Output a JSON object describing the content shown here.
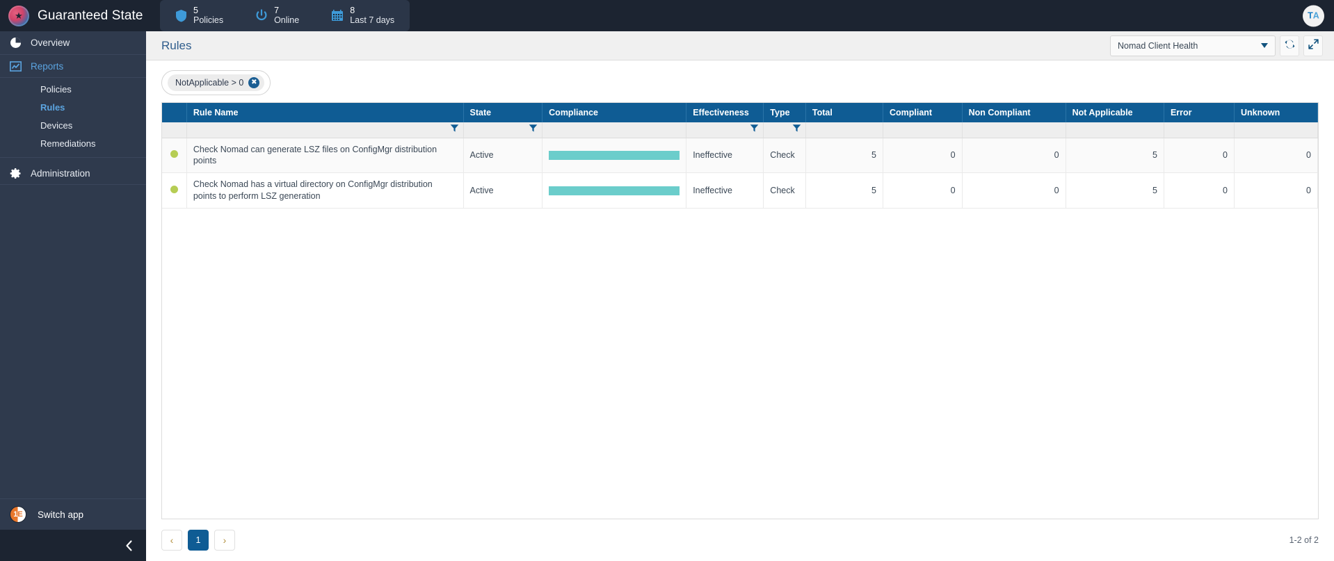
{
  "topbar": {
    "brand": "Guaranteed State",
    "brand_logo_icon": "star-circle-logo",
    "stats": [
      {
        "icon": "shield-icon",
        "value": "5",
        "label": "Policies"
      },
      {
        "icon": "power-icon",
        "value": "7",
        "label": "Online"
      },
      {
        "icon": "calendar-icon",
        "value": "8",
        "label": "Last 7 days"
      }
    ],
    "avatar_initials_1": "T",
    "avatar_initials_2": "A"
  },
  "sidebar": {
    "items": [
      {
        "label": "Overview",
        "icon": "pie-chart-icon"
      },
      {
        "label": "Reports",
        "icon": "line-chart-icon"
      }
    ],
    "report_children": [
      {
        "label": "Policies"
      },
      {
        "label": "Rules"
      },
      {
        "label": "Devices"
      },
      {
        "label": "Remediations"
      }
    ],
    "administration": {
      "label": "Administration",
      "icon": "gear-icon"
    },
    "switch_app": {
      "label": "Switch app",
      "icon": "one-e-logo-icon"
    },
    "collapse_icon": "chevron-left-icon"
  },
  "header": {
    "title": "Rules",
    "policy_select_value": "Nomad Client Health",
    "refresh_icon": "refresh-icon",
    "expand_icon": "expand-icon",
    "dropdown_icon": "chevron-down-icon"
  },
  "filters": {
    "chips": [
      {
        "label": "NotApplicable > 0",
        "remove_icon": "close-circle-icon"
      }
    ]
  },
  "table": {
    "columns": [
      {
        "key": "status",
        "label": "",
        "align": "center"
      },
      {
        "key": "rule_name",
        "label": "Rule Name",
        "align": "left",
        "filterable": true
      },
      {
        "key": "state",
        "label": "State",
        "align": "left",
        "filterable": true
      },
      {
        "key": "compliance",
        "label": "Compliance",
        "align": "left",
        "filterable": false
      },
      {
        "key": "effectiveness",
        "label": "Effectiveness",
        "align": "left",
        "filterable": true
      },
      {
        "key": "type",
        "label": "Type",
        "align": "left",
        "filterable": true
      },
      {
        "key": "total",
        "label": "Total",
        "align": "right",
        "filterable": false
      },
      {
        "key": "compliant",
        "label": "Compliant",
        "align": "right",
        "filterable": false
      },
      {
        "key": "non_compliant",
        "label": "Non Compliant",
        "align": "right",
        "filterable": false
      },
      {
        "key": "not_applicable",
        "label": "Not Applicable",
        "align": "right",
        "filterable": false
      },
      {
        "key": "error",
        "label": "Error",
        "align": "right",
        "filterable": false
      },
      {
        "key": "unknown",
        "label": "Unknown",
        "align": "right",
        "filterable": false
      }
    ],
    "filter_icon": "funnel-icon",
    "rows": [
      {
        "status_icon": "status-dot-warning",
        "rule_name": "Check Nomad can generate LSZ files on ConfigMgr distribution points",
        "state": "Active",
        "compliance_pct": 100,
        "effectiveness": "Ineffective",
        "type": "Check",
        "total": "5",
        "compliant": "0",
        "non_compliant": "0",
        "not_applicable": "5",
        "error": "0",
        "unknown": "0"
      },
      {
        "status_icon": "status-dot-warning",
        "rule_name": "Check Nomad has a virtual directory on ConfigMgr distribution points to perform LSZ generation",
        "state": "Active",
        "compliance_pct": 100,
        "effectiveness": "Ineffective",
        "type": "Check",
        "total": "5",
        "compliant": "0",
        "non_compliant": "0",
        "not_applicable": "5",
        "error": "0",
        "unknown": "0"
      }
    ]
  },
  "pagination": {
    "prev_label": "‹",
    "next_label": "›",
    "pages": [
      "1"
    ],
    "current_page": "1",
    "range_text": "1-2 of 2"
  },
  "colors": {
    "header_blue": "#0f5c94",
    "topbar_dark": "#1c2431",
    "sidebar": "#2f3a4d",
    "accent_link": "#5ba4e0",
    "compliance_bar": "#6bcdcb",
    "status_dot": "#b6cd54"
  }
}
